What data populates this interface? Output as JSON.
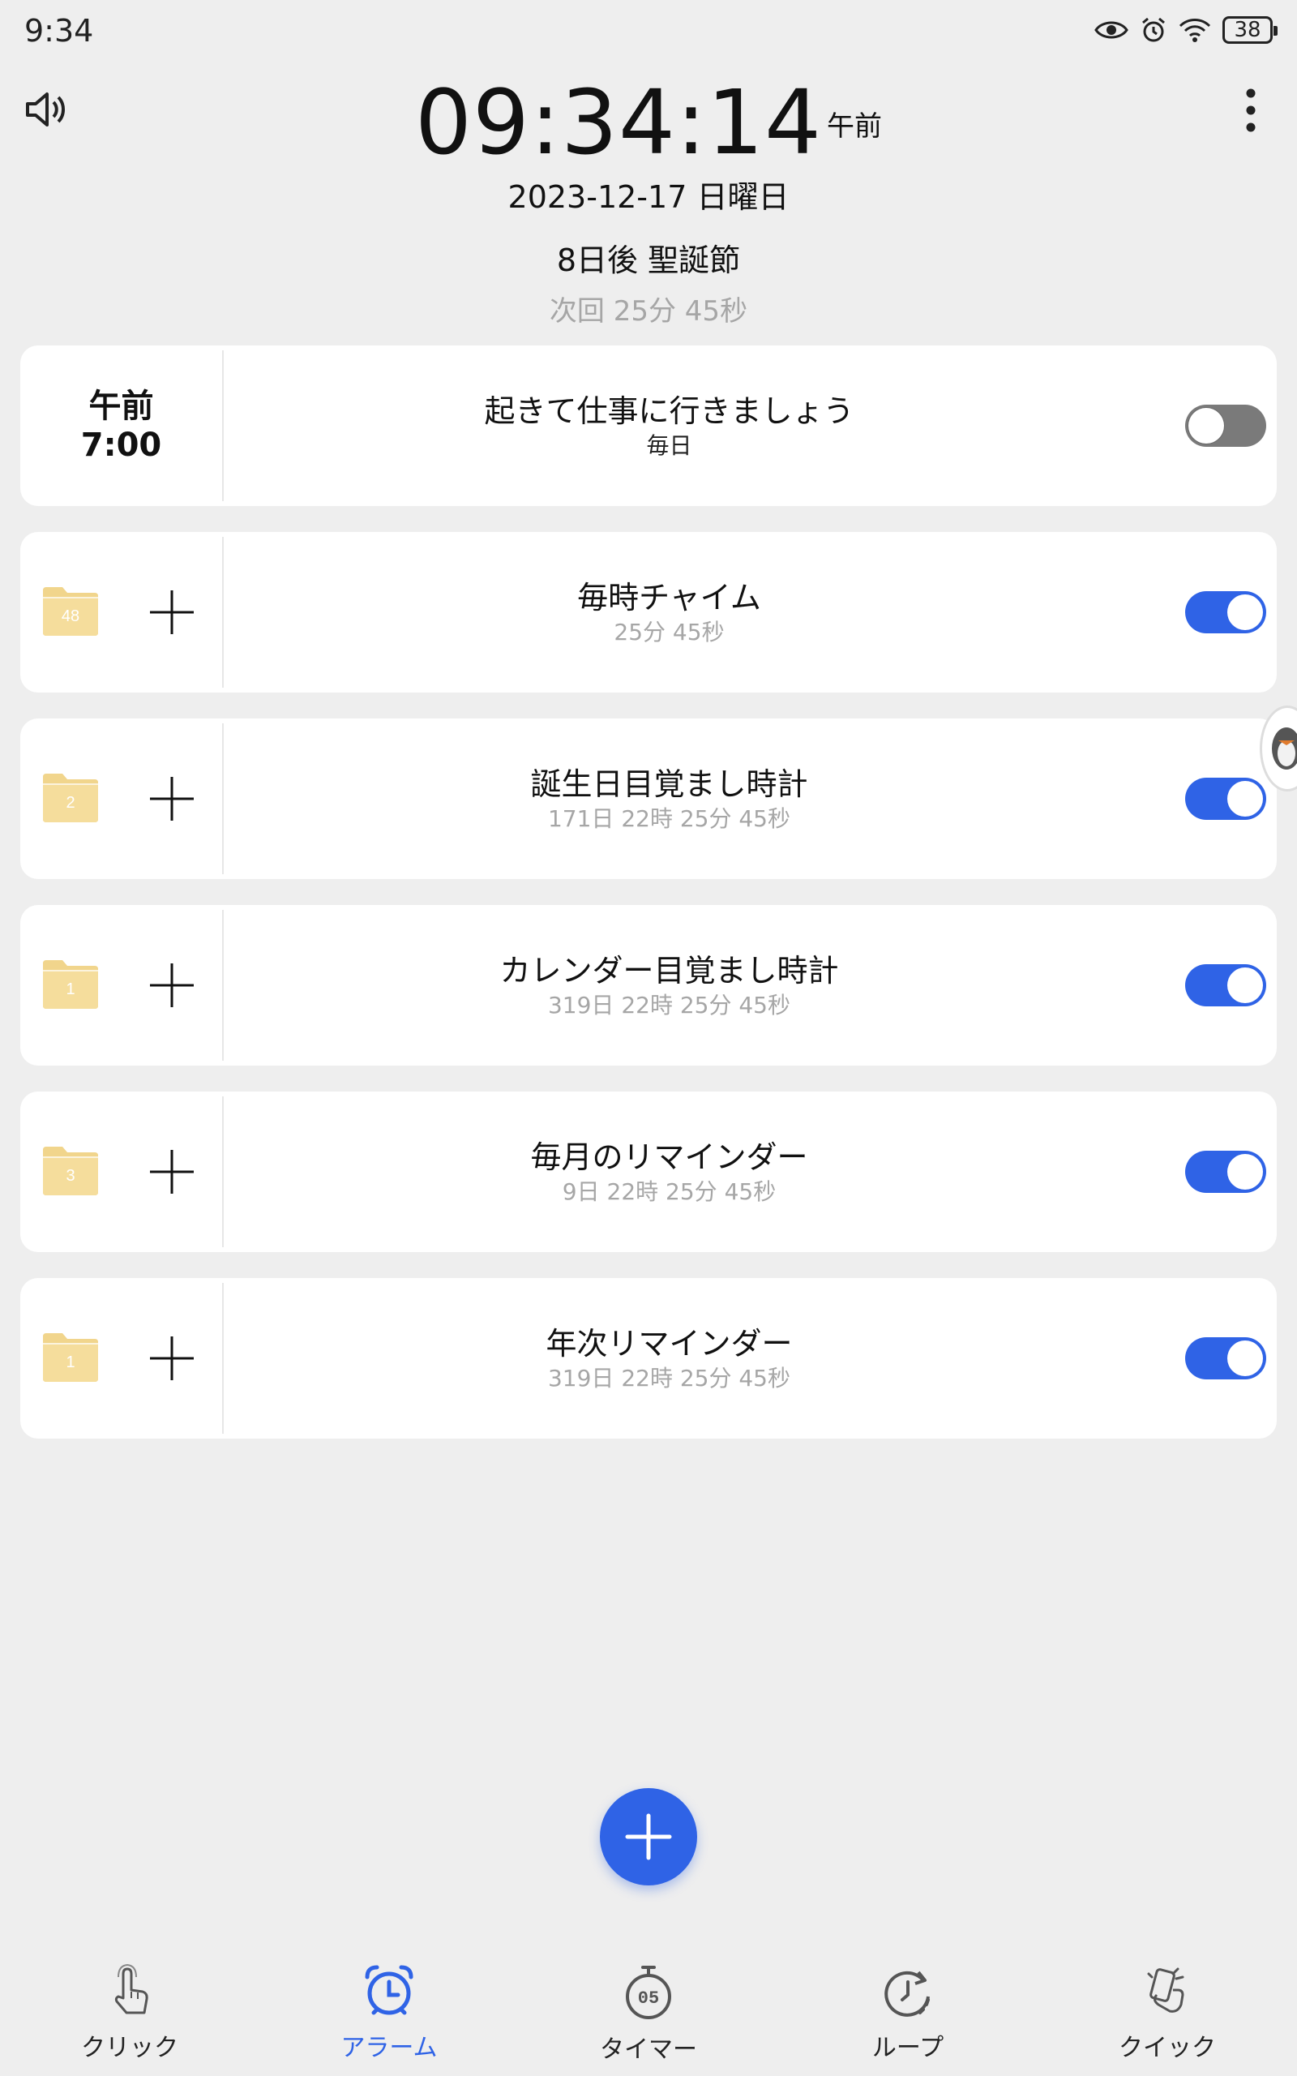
{
  "status": {
    "time": "9:34",
    "battery": "38"
  },
  "clock": {
    "time": "09:34:14",
    "ampm": "午前",
    "date": "2023-12-17 日曜日",
    "holiday": "8日後 聖誕節",
    "next": "次回 25分 45秒"
  },
  "alarms": [
    {
      "ampm": "午前",
      "time": "7:00",
      "title": "起きて仕事に行きましょう",
      "subtitle": "毎日",
      "enabled": false
    },
    {
      "count": "48",
      "title": "毎時チャイム",
      "subtitle": "25分 45秒",
      "enabled": true
    },
    {
      "count": "2",
      "title": "誕生日目覚まし時計",
      "subtitle": "171日 22時 25分 45秒",
      "enabled": true
    },
    {
      "count": "1",
      "title": "カレンダー目覚まし時計",
      "subtitle": "319日 22時 25分 45秒",
      "enabled": true
    },
    {
      "count": "3",
      "title": "毎月のリマインダー",
      "subtitle": "9日 22時 25分 45秒",
      "enabled": true
    },
    {
      "count": "1",
      "title": "年次リマインダー",
      "subtitle": "319日 22時 25分 45秒",
      "enabled": true
    }
  ],
  "nav": {
    "click": "クリック",
    "alarm": "アラーム",
    "timer": "タイマー",
    "loop": "ループ",
    "quick": "クイック",
    "active": "alarm"
  },
  "colors": {
    "accent": "#2f63e6",
    "folder": "#f1d58c",
    "background": "#eeeeee"
  },
  "icons": [
    "eye-icon",
    "alarm-status-icon",
    "wifi-icon",
    "battery-icon",
    "speaker-icon",
    "more-vert-icon",
    "folder-icon",
    "plus-icon",
    "add-fab-icon",
    "click-hand-icon",
    "alarm-clock-icon",
    "stopwatch-icon",
    "loop-clock-icon",
    "quick-icon"
  ]
}
